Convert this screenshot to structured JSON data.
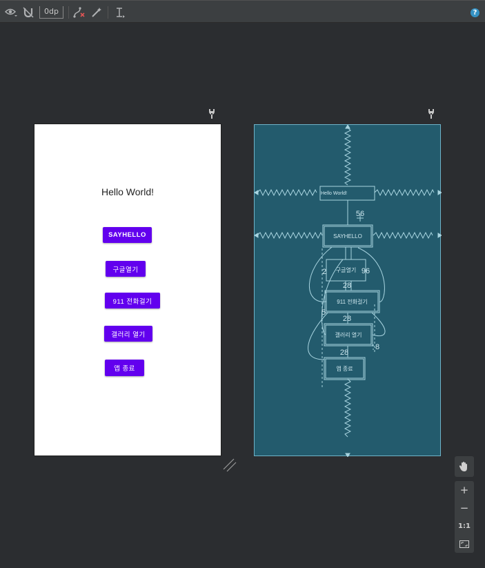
{
  "toolbar": {
    "margin_value": "0dp",
    "help_symbol": "?"
  },
  "phone": {
    "hello_text": "Hello World!",
    "buttons": [
      "SAYHELLO",
      "구글열기",
      "911 전화걸기",
      "갤러리 열기",
      "앱 종료"
    ],
    "button_color": "#6200ee"
  },
  "blueprint": {
    "hello_text": "Hello World!",
    "buttons": [
      "SAYHELLO",
      "구글열기",
      "911 전화걸기",
      "갤러리 열기",
      "앱 종료"
    ],
    "margins": [
      "56",
      "96",
      "28",
      "28",
      "28"
    ],
    "side_labels": [
      "5",
      "8",
      "2"
    ],
    "background_color": "#235b6d"
  },
  "zoom": {
    "zoom_in": "+",
    "zoom_out": "−",
    "actual_size": "1:1"
  }
}
